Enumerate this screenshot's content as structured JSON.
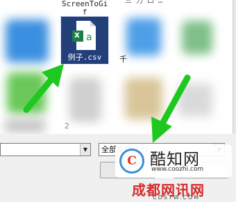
{
  "file_list": {
    "items": [
      {
        "caption_line1": "ScreenToGi",
        "caption_line2": "f"
      },
      {
        "name": "例子.csv",
        "icon_letters": "x",
        "icon_letters_small": "a"
      },
      {
        "partial_char_right": "千"
      },
      {
        "partial_char_bottom": "2"
      }
    ],
    "top_partial": "三 力 口 …"
  },
  "file_type_select": {
    "value": "全部文件(*.*)"
  },
  "arrows_color": "#1ec81e",
  "watermark": {
    "logo_letter": "C",
    "title": "酷知网",
    "url": "www.coozhi.com"
  },
  "site_banner": {
    "title": "成都网讯网",
    "url": "CDSTW.COM"
  }
}
